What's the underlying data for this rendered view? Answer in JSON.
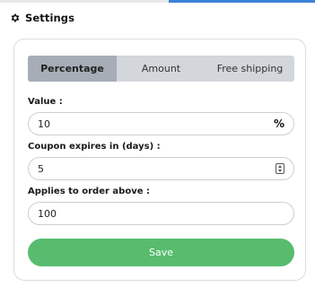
{
  "header": {
    "title": "Settings",
    "icon": "gear-icon"
  },
  "tabs": [
    {
      "label": "Percentage",
      "active": true
    },
    {
      "label": "Amount",
      "active": false
    },
    {
      "label": "Free shipping",
      "active": false
    }
  ],
  "fields": {
    "value": {
      "label": "Value :",
      "value": "10",
      "suffix": "%"
    },
    "expires": {
      "label": "Coupon expires in (days) :",
      "value": "5"
    },
    "min_order": {
      "label": "Applies to order above :",
      "value": "100"
    }
  },
  "save_label": "Save",
  "colors": {
    "accent": "#3b82d6",
    "save": "#57bc6e",
    "tab_active": "#a6adb6",
    "tab_bg": "#d3d6da"
  }
}
